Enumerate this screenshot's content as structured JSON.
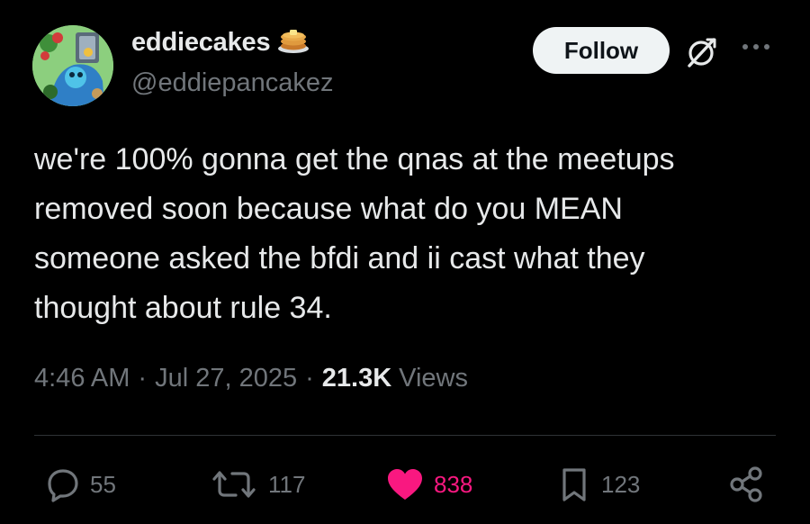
{
  "author": {
    "display_name": "eddiecakes",
    "handle": "@eddiepancakez",
    "badge_icon": "pancake-emoji-icon"
  },
  "header": {
    "follow_label": "Follow",
    "grok_icon": "grok-icon",
    "more_icon": "more-options-icon"
  },
  "tweet": {
    "text": "we're 100% gonna get the qnas at the meetups\nremoved soon because what do you MEAN\nsomeone asked the bfdi and ii cast what they\nthought about rule 34."
  },
  "meta": {
    "time": "4:46 AM",
    "separator_1": "·",
    "date": "Jul 27, 2025",
    "separator_2": "·",
    "views_count": "21.3K",
    "views_label": "Views"
  },
  "actions": {
    "replies": "55",
    "reposts": "117",
    "likes": "838",
    "bookmarks": "123"
  },
  "colors": {
    "background": "#000000",
    "primary_text": "#e7e9ea",
    "secondary_text": "#71767b",
    "like_pink": "#f91880",
    "follow_bg": "#eff3f4",
    "divider": "#2f3336"
  }
}
